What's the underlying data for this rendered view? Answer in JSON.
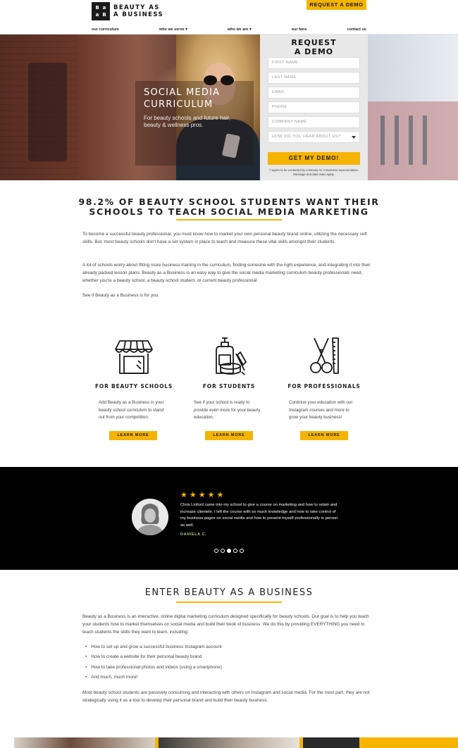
{
  "header": {
    "logo_mark": [
      "B",
      "a",
      "a",
      "B"
    ],
    "logo_line1": "BEAUTY AS",
    "logo_line2": "A BUSINESS",
    "cta": "REQUEST A DEMO",
    "nav": [
      "our curriculum",
      "who we serve ▾",
      "who we are ▾",
      "our fans",
      "contact us"
    ]
  },
  "hero": {
    "title_line1": "SOCIAL MEDIA",
    "title_line2": "CURRICULUM",
    "subtitle": "For beauty schools and future hair, beauty & wellness pros."
  },
  "form": {
    "title_line1": "REQUEST",
    "title_line2": "A DEMO",
    "fields": [
      "FIRST NAME",
      "LAST NAME",
      "EMAIL",
      "PHONE",
      "COMPANY NAME"
    ],
    "select_placeholder": "HOW DID YOU HEAR ABOUT US?",
    "submit": "GET MY DEMO!",
    "note": "*I agree to be contacted by a Beauty As A Business representative. Message and data rates apply."
  },
  "section1": {
    "title_line1": "98.2% OF BEAUTY SCHOOL STUDENTS WANT THEIR",
    "title_line2": "SCHOOLS TO TEACH SOCIAL MEDIA MARKETING",
    "p1": "To become a successful beauty professional, you must know how to market your own personal beauty brand online, utilizing the necessary soft skills. But, most beauty schools don't have a set system in place to teach and measure these vital skills amongst their students.",
    "p2": "A lot of schools worry about fitting more business training in the curriculum, finding someone with the right experience, and integrating it into their already packed lesson plans. Beauty as a Business is an easy way to give the social media marketing curriculum beauty professionals need, whether you're a beauty school, a beauty school student, or current beauty professional.",
    "p3": "See if Beauty as a Business is for you."
  },
  "cards": [
    {
      "icon": "storefront-icon",
      "title": "FOR BEAUTY SCHOOLS",
      "text": "Add Beauty as a Business in your beauty school curriculum to stand out from your competition.",
      "button": "LEARN MORE"
    },
    {
      "icon": "beauty-products-icon",
      "title": "FOR STUDENTS",
      "text": "See if your school is ready to provide even more for your beauty education.",
      "button": "LEARN MORE"
    },
    {
      "icon": "scissors-comb-icon",
      "title": "FOR PROFESSIONALS",
      "text": "Continue your education with our Instagram courses and more to grow your beauty business!",
      "button": "LEARN MORE"
    }
  ],
  "testimonial": {
    "stars": "★★★★★",
    "rating": 5,
    "quote": "Chris Linford came into my school to give a course on marketing and how to retain and increase clientele. I left the course with so much knowledge and how to take control of my business pages on social media and how to present myself professionally in person as well.",
    "author": "DANIELA C.",
    "slides": 5,
    "active_slide": 3
  },
  "section2": {
    "title": "ENTER BEAUTY AS A BUSINESS",
    "p1": "Beauty as a Business is an interactive, online digital marketing curriculum designed specifically for beauty schools. Our goal is to help you teach your students how to market themselves on social media and build their book of business. We do this by providing EVERYTHING you need to teach students the skills they want to learn, including:",
    "bullets": [
      "How to set up and grow a successful business Instagram account",
      "How to create a website for their personal beauty brand",
      "How to take professional photos and videos (using a smartphone)",
      "And much, much more!"
    ],
    "p2": "Most beauty school students are passively consuming and interacting with others on Instagram and social media. For the most part, they are not strategically using it as a tool to develop their personal brand and build their beauty business."
  },
  "colors": {
    "accent": "#f5b400",
    "dark": "#000000",
    "author": "#a8c97a"
  }
}
